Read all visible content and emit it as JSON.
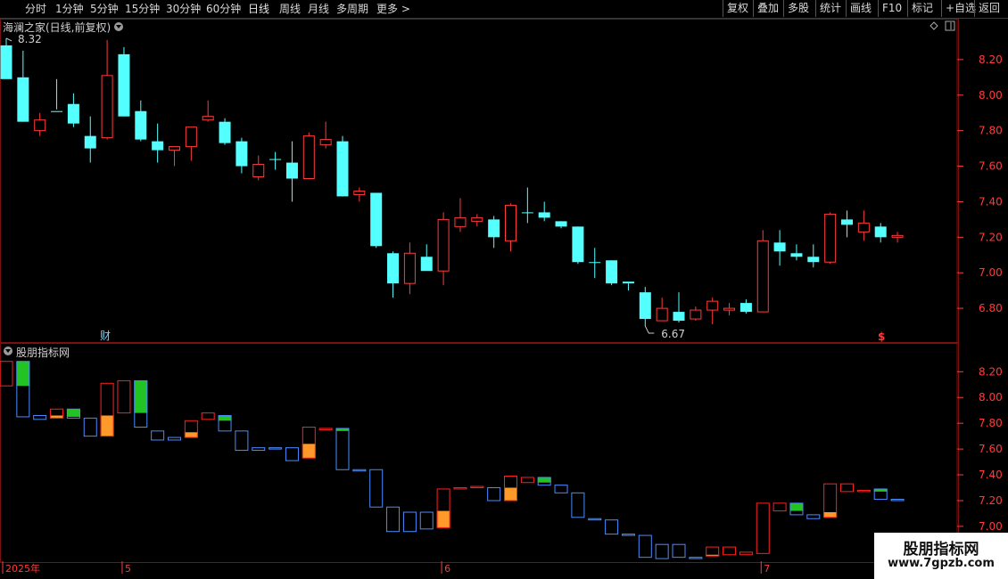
{
  "toolbar": {
    "periods": [
      "分时",
      "1分钟",
      "5分钟",
      "15分钟",
      "30分钟",
      "60分钟",
      "日线",
      "周线",
      "月线",
      "多周期",
      "更多 >"
    ],
    "active_period": "日线",
    "right_buttons": [
      "复权",
      "叠加",
      "多股",
      "统计",
      "画线",
      "F10",
      "标记",
      "+自选",
      "返回"
    ]
  },
  "panel1": {
    "title": "海澜之家(日线,前复权)"
  },
  "panel2": {
    "title": "股朋指标网"
  },
  "annotations": {
    "high_label": "8.32",
    "low_label": "6.67",
    "fin_marker": "财",
    "s_marker": "$"
  },
  "watermark": {
    "line1": "股朋指标网",
    "line2": "www.7gpzb.com"
  },
  "colors": {
    "up": "#ff3b3b",
    "down": "#54ffff",
    "axis": "#ff3b3b",
    "box_down": "#4a8cff",
    "box_up": "#ff2020",
    "green_fill": "#22c322",
    "orange_fill": "#ff9a2a"
  },
  "chart_data": [
    {
      "type": "candlestick",
      "title": "海澜之家(日线,前复权)",
      "y_ticks": [
        6.8,
        7.0,
        7.2,
        7.4,
        7.6,
        7.8,
        8.0,
        8.2
      ],
      "ylim": [
        6.61,
        8.43
      ],
      "x_ticks": [
        "2025年",
        "5",
        "6",
        "7"
      ],
      "x_tick_index": [
        0,
        7,
        26,
        45
      ],
      "ohlc": [
        [
          8.28,
          8.32,
          8.12,
          8.09
        ],
        [
          8.1,
          8.25,
          7.85,
          7.85
        ],
        [
          7.8,
          7.9,
          7.77,
          7.86
        ],
        [
          7.91,
          8.09,
          7.92,
          7.91
        ],
        [
          7.95,
          8.01,
          7.82,
          7.84
        ],
        [
          7.77,
          7.88,
          7.62,
          7.7
        ],
        [
          7.76,
          8.31,
          7.75,
          8.11
        ],
        [
          8.23,
          8.27,
          7.88,
          7.88
        ],
        [
          7.91,
          7.97,
          7.74,
          7.75
        ],
        [
          7.74,
          7.84,
          7.62,
          7.69
        ],
        [
          7.69,
          7.7,
          7.6,
          7.71
        ],
        [
          7.71,
          7.82,
          7.63,
          7.82
        ],
        [
          7.86,
          7.97,
          7.85,
          7.88
        ],
        [
          7.85,
          7.87,
          7.72,
          7.73
        ],
        [
          7.74,
          7.76,
          7.56,
          7.6
        ],
        [
          7.54,
          7.66,
          7.52,
          7.61
        ],
        [
          7.64,
          7.68,
          7.58,
          7.64
        ],
        [
          7.62,
          7.74,
          7.4,
          7.53
        ],
        [
          7.53,
          7.79,
          7.53,
          7.77
        ],
        [
          7.72,
          7.85,
          7.7,
          7.75
        ],
        [
          7.74,
          7.77,
          7.43,
          7.43
        ],
        [
          7.44,
          7.48,
          7.4,
          7.46
        ],
        [
          7.45,
          7.45,
          7.14,
          7.15
        ],
        [
          7.11,
          7.12,
          6.86,
          6.94
        ],
        [
          6.94,
          7.17,
          6.88,
          7.11
        ],
        [
          7.09,
          7.16,
          7.03,
          7.01
        ],
        [
          7.01,
          7.34,
          6.93,
          7.3
        ],
        [
          7.26,
          7.42,
          7.23,
          7.31
        ],
        [
          7.29,
          7.33,
          7.26,
          7.31
        ],
        [
          7.3,
          7.32,
          7.14,
          7.2
        ],
        [
          7.18,
          7.39,
          7.12,
          7.38
        ],
        [
          7.34,
          7.48,
          7.28,
          7.34
        ],
        [
          7.34,
          7.4,
          7.29,
          7.31
        ],
        [
          7.29,
          7.29,
          7.25,
          7.26
        ],
        [
          7.26,
          7.26,
          7.05,
          7.06
        ],
        [
          7.06,
          7.14,
          6.97,
          7.06
        ],
        [
          7.07,
          7.07,
          6.93,
          6.94
        ],
        [
          6.95,
          6.94,
          6.9,
          6.94
        ],
        [
          6.89,
          6.92,
          6.7,
          6.74
        ],
        [
          6.73,
          6.86,
          6.73,
          6.8
        ],
        [
          6.78,
          6.89,
          6.72,
          6.73
        ],
        [
          6.74,
          6.81,
          6.73,
          6.79
        ],
        [
          6.79,
          6.86,
          6.71,
          6.84
        ],
        [
          6.79,
          6.83,
          6.76,
          6.8
        ],
        [
          6.83,
          6.85,
          6.77,
          6.78
        ],
        [
          6.78,
          7.24,
          6.78,
          7.18
        ],
        [
          7.17,
          7.24,
          7.04,
          7.12
        ],
        [
          7.11,
          7.16,
          7.07,
          7.09
        ],
        [
          7.09,
          7.16,
          7.03,
          7.06
        ],
        [
          7.06,
          7.34,
          7.05,
          7.33
        ],
        [
          7.3,
          7.35,
          7.2,
          7.27
        ],
        [
          7.23,
          7.35,
          7.18,
          7.28
        ],
        [
          7.26,
          7.28,
          7.17,
          7.2
        ],
        [
          7.2,
          7.23,
          7.17,
          7.21
        ]
      ]
    },
    {
      "type": "bar",
      "title": "股朋指标网",
      "y_ticks": [
        7.0,
        7.2,
        7.4,
        7.6,
        7.8,
        8.0,
        8.2
      ],
      "ylim": [
        6.73,
        8.43
      ],
      "boxes": [
        [
          8.28,
          8.09,
          "red",
          null
        ],
        [
          8.28,
          7.85,
          "blue",
          "g8.09"
        ],
        [
          7.86,
          7.83,
          "blue",
          null
        ],
        [
          7.91,
          7.84,
          "red",
          "o7.86"
        ],
        [
          7.91,
          7.84,
          "blue",
          "g7.85"
        ],
        [
          7.84,
          7.7,
          "blue",
          null
        ],
        [
          8.11,
          7.7,
          "red",
          "o7.86"
        ],
        [
          8.13,
          7.88,
          "red",
          null
        ],
        [
          8.13,
          7.77,
          "blue",
          "g7.88"
        ],
        [
          7.74,
          7.67,
          "blue",
          null
        ],
        [
          7.69,
          7.67,
          "blue",
          null
        ],
        [
          7.82,
          7.69,
          "red",
          "o7.73"
        ],
        [
          7.88,
          7.83,
          "red",
          null
        ],
        [
          7.86,
          7.74,
          "blue",
          "g7.82"
        ],
        [
          7.74,
          7.59,
          "blue",
          null
        ],
        [
          7.61,
          7.59,
          "blue",
          null
        ],
        [
          7.61,
          7.6,
          "blue",
          null
        ],
        [
          7.61,
          7.51,
          "blue",
          null
        ],
        [
          7.77,
          7.53,
          "red",
          "o7.64"
        ],
        [
          7.76,
          7.75,
          "red",
          null
        ],
        [
          7.76,
          7.44,
          "blue",
          "g7.74"
        ],
        [
          7.44,
          7.43,
          "blue",
          null
        ],
        [
          7.44,
          7.15,
          "blue",
          null
        ],
        [
          7.15,
          6.96,
          "blue",
          null
        ],
        [
          7.11,
          6.96,
          "blue",
          null
        ],
        [
          7.11,
          6.98,
          "blue",
          null
        ],
        [
          7.29,
          6.99,
          "red",
          "o7.12"
        ],
        [
          7.3,
          7.29,
          "red",
          null
        ],
        [
          7.31,
          7.3,
          "red",
          null
        ],
        [
          7.3,
          7.2,
          "blue",
          null
        ],
        [
          7.39,
          7.2,
          "red",
          "o7.30"
        ],
        [
          7.38,
          7.34,
          "red",
          null
        ],
        [
          7.38,
          7.32,
          "blue",
          "g7.34"
        ],
        [
          7.32,
          7.26,
          "blue",
          null
        ],
        [
          7.26,
          7.07,
          "blue",
          null
        ],
        [
          7.06,
          7.05,
          "blue",
          null
        ],
        [
          7.05,
          6.94,
          "blue",
          null
        ],
        [
          6.94,
          6.93,
          "blue",
          null
        ],
        [
          6.93,
          6.76,
          "blue",
          null
        ],
        [
          6.86,
          6.75,
          "blue",
          null
        ],
        [
          6.86,
          6.76,
          "blue",
          null
        ],
        [
          6.76,
          6.75,
          "blue",
          null
        ],
        [
          6.84,
          6.77,
          "red",
          "o6.78"
        ],
        [
          6.84,
          6.78,
          "red",
          null
        ],
        [
          6.8,
          6.78,
          "red",
          null
        ],
        [
          7.18,
          6.79,
          "red",
          null
        ],
        [
          7.18,
          7.12,
          "red",
          null
        ],
        [
          7.18,
          7.09,
          "blue",
          "g7.12"
        ],
        [
          7.09,
          7.06,
          "blue",
          null
        ],
        [
          7.33,
          7.07,
          "red",
          "o7.11"
        ],
        [
          7.33,
          7.27,
          "red",
          null
        ],
        [
          7.28,
          7.27,
          "red",
          null
        ],
        [
          7.29,
          7.21,
          "blue",
          "g7.27"
        ],
        [
          7.21,
          7.2,
          "blue",
          null
        ]
      ]
    }
  ]
}
